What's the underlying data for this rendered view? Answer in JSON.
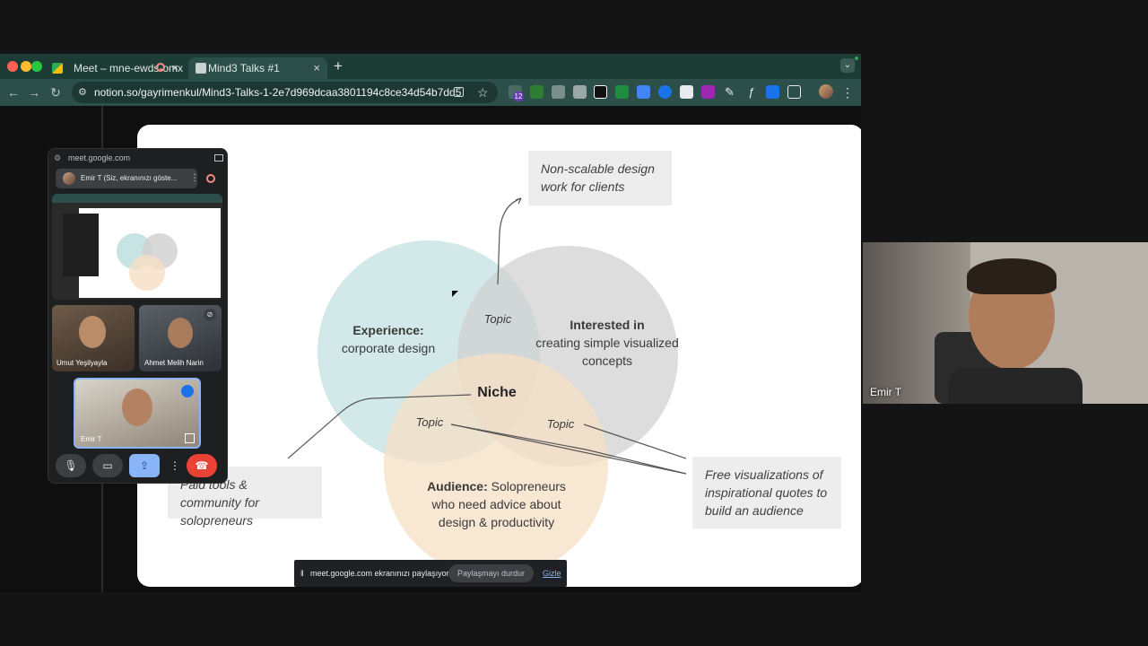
{
  "browser": {
    "tabs": [
      {
        "title": "Meet – mne-ewds-omx",
        "active": false
      },
      {
        "title": "Mind3 Talks #1",
        "active": true
      }
    ],
    "url": "notion.so/gayrimenkul/Mind3-Talks-1-2e7d969dcaa3801194c8ce34d54b7dd5",
    "extension_badge": "12"
  },
  "slide": {
    "top_note": "Non-scalable design work for clients",
    "left_note": "Paid tools & community for solopreneurs",
    "right_note": "Free visualizations of inspirational quotes to build an audience",
    "experience_bold": "Experience:",
    "experience_rest": "corporate design",
    "interested_bold": "Interested in",
    "interested_rest": "creating simple visualized concepts",
    "audience_bold": "Audience:",
    "audience_rest_1": "Solopreneurs",
    "audience_rest_2": "who need advice about design & productivity",
    "niche": "Niche",
    "topic_top": "Topic",
    "topic_left": "Topic",
    "topic_right": "Topic"
  },
  "meet_pip": {
    "domain": "meet.google.com",
    "presenter": "Emir T (Siz, ekranınızı göste...",
    "participants": [
      {
        "name": "Umut Yeşilyayla"
      },
      {
        "name": "Ahmet Melih Narin"
      },
      {
        "name": "Emir T"
      }
    ]
  },
  "right_video": {
    "name": "Emir T"
  },
  "share_bar": {
    "message": "meet.google.com ekranınızı paylaşıyor.",
    "stop": "Paylaşmayı durdur",
    "hide": "Gizle"
  },
  "colors": {
    "tabbar": "#1d3c36",
    "toolbar": "#2d4f49",
    "end_call": "#ea4335",
    "share_active": "#8ab4f8"
  }
}
